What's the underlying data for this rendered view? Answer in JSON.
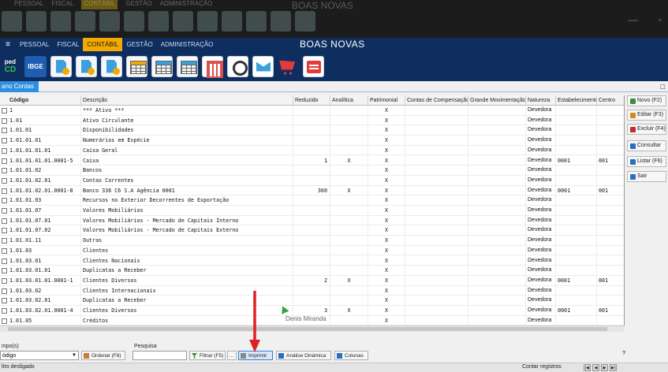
{
  "ghost": {
    "menu": [
      "PESSOAL",
      "FISCAL",
      "CONTÁBIL",
      "GESTÃO",
      "ADMINISTRAÇÃO"
    ],
    "title": "BOAS NOVAS"
  },
  "titlebar": {
    "menu": [
      "PESSOAL",
      "FISCAL",
      "CONTÁBIL",
      "GESTÃO",
      "ADMINISTRAÇÃO"
    ],
    "active_menu": "CONTÁBIL",
    "title": "BOAS NOVAS"
  },
  "toolbar": {
    "sped_top": "ped",
    "sped_bottom": "CD",
    "ibge": "IBGE",
    "icons": [
      "sped-icon",
      "ibge-icon",
      "document-icon",
      "document-icon",
      "document-icon",
      "grid-icon",
      "grid-icon",
      "grid-search-icon",
      "calendar-icon",
      "clock-icon",
      "envelope-icon",
      "cart-icon",
      "cash-register-icon"
    ]
  },
  "tab": {
    "label": "ano Contas",
    "close": "□"
  },
  "grid": {
    "headers": [
      "Código",
      "Descrição",
      "Reduzido",
      "Analítica",
      "Patrimonial",
      "Contas de Compensação",
      "Grande Movimentação",
      "Natureza",
      "Estabelecimento",
      "Centro"
    ],
    "rows": [
      [
        "1",
        "*** Ativo ***",
        "",
        "",
        "X",
        "",
        "",
        "Devedora",
        "",
        ""
      ],
      [
        "1.01",
        "Ativo Circulante",
        "",
        "",
        "X",
        "",
        "",
        "Devedora",
        "",
        ""
      ],
      [
        "1.01.01",
        "Disponibilidades",
        "",
        "",
        "X",
        "",
        "",
        "Devedora",
        "",
        ""
      ],
      [
        "1.01.01.01",
        "Numerários em Espécie",
        "",
        "",
        "X",
        "",
        "",
        "Devedora",
        "",
        ""
      ],
      [
        "1.01.01.01.01",
        "Caixa Geral",
        "",
        "",
        "X",
        "",
        "",
        "Devedora",
        "",
        ""
      ],
      [
        "1.01.01.01.01.0001-5",
        "Caixa",
        "1",
        "X",
        "X",
        "",
        "",
        "Devedora",
        "0001",
        "001"
      ],
      [
        "1.01.01.02",
        "Bancos",
        "",
        "",
        "X",
        "",
        "",
        "Devedora",
        "",
        ""
      ],
      [
        "1.01.01.02.01",
        "Contas Correntes",
        "",
        "",
        "X",
        "",
        "",
        "Devedora",
        "",
        ""
      ],
      [
        "1.01.01.02.01.0001-8",
        "Banco 336 C6 S.A Agência 0001",
        "360",
        "X",
        "X",
        "",
        "",
        "Devedora",
        "0001",
        "001"
      ],
      [
        "1.01.01.03",
        "Recursos no Exterior Decorrentes de Exportação",
        "",
        "",
        "X",
        "",
        "",
        "Devedora",
        "",
        ""
      ],
      [
        "1.01.01.07",
        "Valores Mobiliários",
        "",
        "",
        "X",
        "",
        "",
        "Devedora",
        "",
        ""
      ],
      [
        "1.01.01.07.01",
        "Valores Mobiliários - Mercado de Capitais Interno",
        "",
        "",
        "X",
        "",
        "",
        "Devedora",
        "",
        ""
      ],
      [
        "1.01.01.07.02",
        "Valores Mobiliários - Mercado de Capitais Externo",
        "",
        "",
        "X",
        "",
        "",
        "Devedora",
        "",
        ""
      ],
      [
        "1.01.01.11",
        "Outras",
        "",
        "",
        "X",
        "",
        "",
        "Devedora",
        "",
        ""
      ],
      [
        "1.01.03",
        "Clientes",
        "",
        "",
        "X",
        "",
        "",
        "Devedora",
        "",
        ""
      ],
      [
        "1.01.03.01",
        "Clientes Nacionais",
        "",
        "",
        "X",
        "",
        "",
        "Devedora",
        "",
        ""
      ],
      [
        "1.01.03.01.01",
        "Duplicatas a Receber",
        "",
        "",
        "X",
        "",
        "",
        "Devedora",
        "",
        ""
      ],
      [
        "1.01.03.01.01.0001-1",
        "Clientes Diversos",
        "2",
        "X",
        "X",
        "",
        "",
        "Devedora",
        "0001",
        "001"
      ],
      [
        "1.01.03.02",
        "Clientes Internacionais",
        "",
        "",
        "X",
        "",
        "",
        "Devedora",
        "",
        ""
      ],
      [
        "1.01.03.02.01",
        "Duplicatas a Receber",
        "",
        "",
        "X",
        "",
        "",
        "Devedora",
        "",
        ""
      ],
      [
        "1.01.03.02.01.0001-4",
        "Clientes Diversos",
        "3",
        "X",
        "X",
        "",
        "",
        "Devedora",
        "0001",
        "001"
      ],
      [
        "1.01.05",
        "Créditos",
        "",
        "",
        "X",
        "",
        "",
        "Devedora",
        "",
        ""
      ]
    ]
  },
  "side_buttons": [
    {
      "label": "Novo (F2)",
      "icon": "new-icon",
      "color": "#3a8f3a"
    },
    {
      "label": "Editar (F3)",
      "icon": "edit-icon",
      "color": "#d08a20"
    },
    {
      "label": "Excluir (F4)",
      "icon": "delete-icon",
      "color": "#c03030"
    },
    {
      "label": "Consultar",
      "icon": "search-icon",
      "color": "#2a70c0"
    },
    {
      "label": "Listar (F6)",
      "icon": "list-icon",
      "color": "#2a70c0"
    },
    {
      "label": "Sair",
      "icon": "exit-icon",
      "color": "#2a70c0"
    }
  ],
  "bottom": {
    "campo_label": "mpo(s)",
    "campo_value": "ódigo",
    "ordenar": "Ordenar (F8)",
    "pesquisa_label": "Pesquisa",
    "pesquisa_value": "",
    "filtrar": "Filtrar (F5)",
    "ellipsis": "...",
    "imprimir": "Imprimir",
    "analise": "Análise Dinâmica",
    "colunas": "Colunas",
    "help": "?",
    "status": "ltro desligado",
    "contar": "Contar registros",
    "nav": [
      "|◀",
      "◀",
      "▶",
      "▶|"
    ]
  },
  "watermark": "Denis Miranda"
}
